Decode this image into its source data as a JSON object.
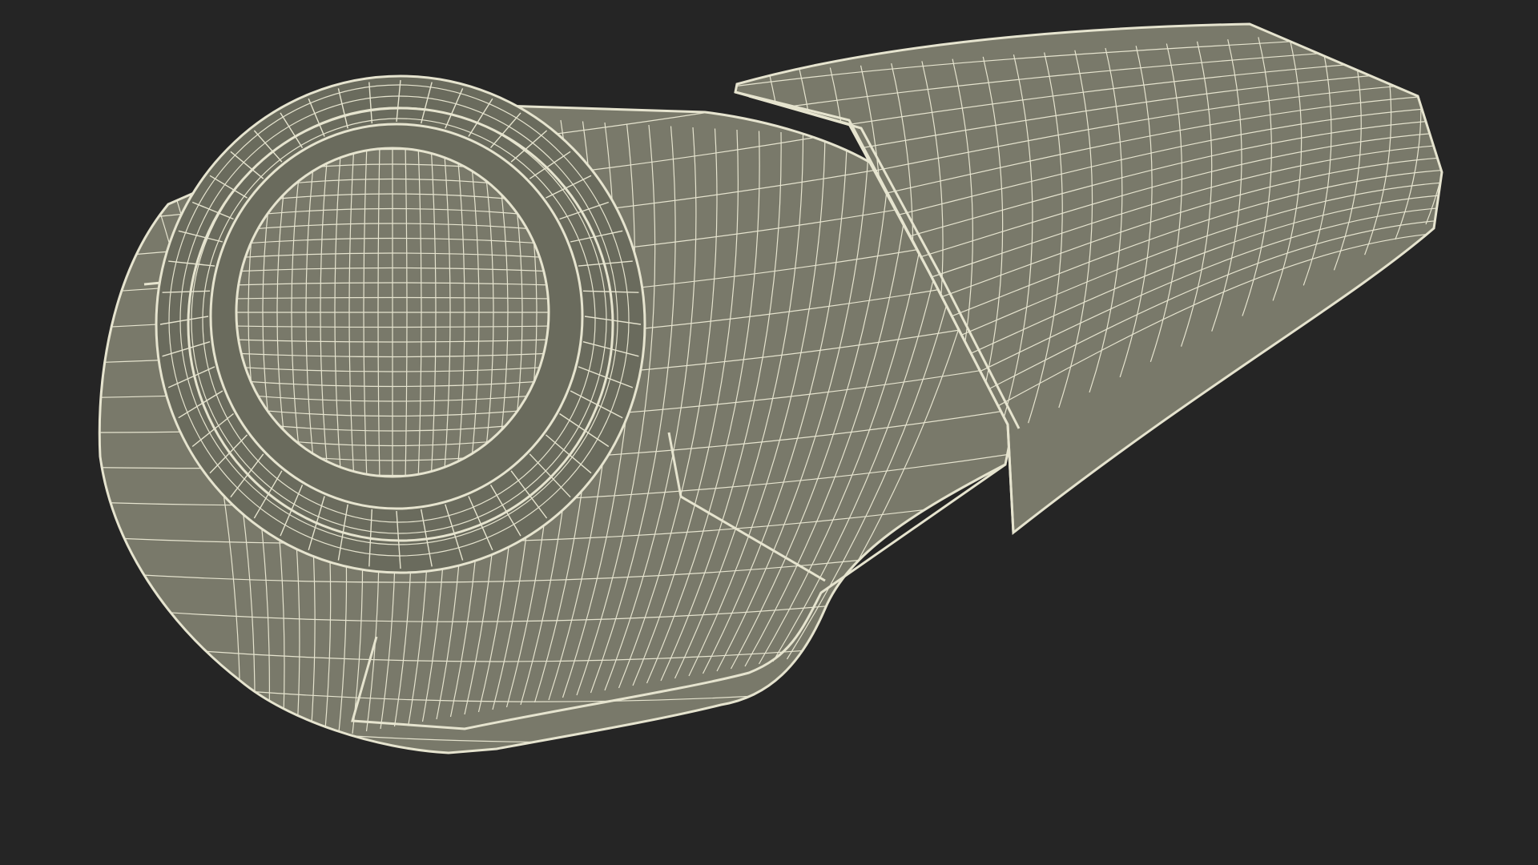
{
  "scene": {
    "subject": "wireframe-mesh-render",
    "colors": {
      "background": "#252525",
      "surface": "#79796a",
      "surface_shade": "#6a6b5d",
      "wire": "#e6e4cf"
    }
  }
}
